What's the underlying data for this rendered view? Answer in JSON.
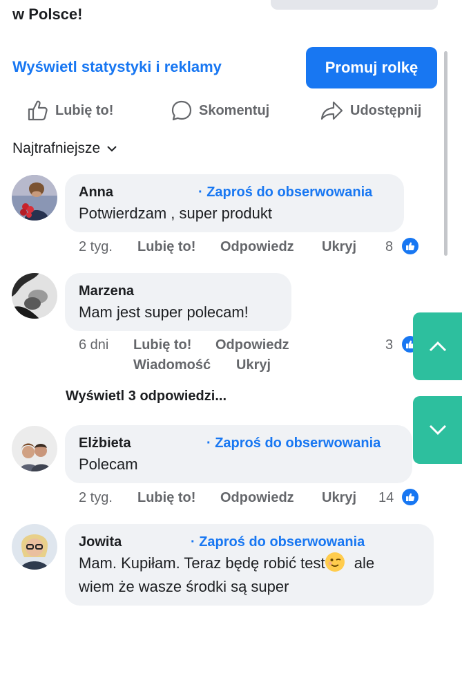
{
  "post": {
    "text_tail": "w Polsce!",
    "stats_link": "Wyświetl statystyki i reklamy",
    "promote_button": "Promuj rolkę"
  },
  "actions": {
    "like": "Lubię to!",
    "comment": "Skomentuj",
    "share": "Udostępnij"
  },
  "sort": {
    "label": "Najtrafniejsze"
  },
  "comments": [
    {
      "author": "Anna",
      "invite": "· Zaproś do obserwowania",
      "text": "Potwierdzam , super produkt",
      "time": "2 tyg.",
      "like": "Lubię to!",
      "reply": "Odpowiedz",
      "hide": "Ukryj",
      "reactions": "8"
    },
    {
      "author": "Marzena",
      "text": "Mam jest super polecam!",
      "time": "6 dni",
      "like": "Lubię to!",
      "reply": "Odpowiedz",
      "message": "Wiadomość",
      "hide": "Ukryj",
      "reactions": "3"
    },
    {
      "author": "Elżbieta",
      "invite": "· Zaproś do obserwowania",
      "text": "Polecam",
      "time": "2 tyg.",
      "like": "Lubię to!",
      "reply": "Odpowiedz",
      "hide": "Ukryj",
      "reactions": "14"
    },
    {
      "author": "Jowita",
      "invite": "· Zaproś do obserwowania",
      "text_line1": "Mam. Kupiłam. Teraz będę robić test",
      "text_line1_end": "ale",
      "text_line2": "wiem że wasze środki są super"
    }
  ],
  "view_replies": "Wyświetl 3 odpowiedzi...",
  "colors": {
    "accent": "#1877f2",
    "scroll_button": "#2dbf9e",
    "bubble": "#f0f2f5",
    "meta": "#65676b"
  },
  "icons": [
    "thumbs-up-icon",
    "comment-icon",
    "share-icon",
    "chevron-down-icon",
    "like-badge-icon",
    "wink-emoji-icon",
    "chevron-up-icon"
  ]
}
